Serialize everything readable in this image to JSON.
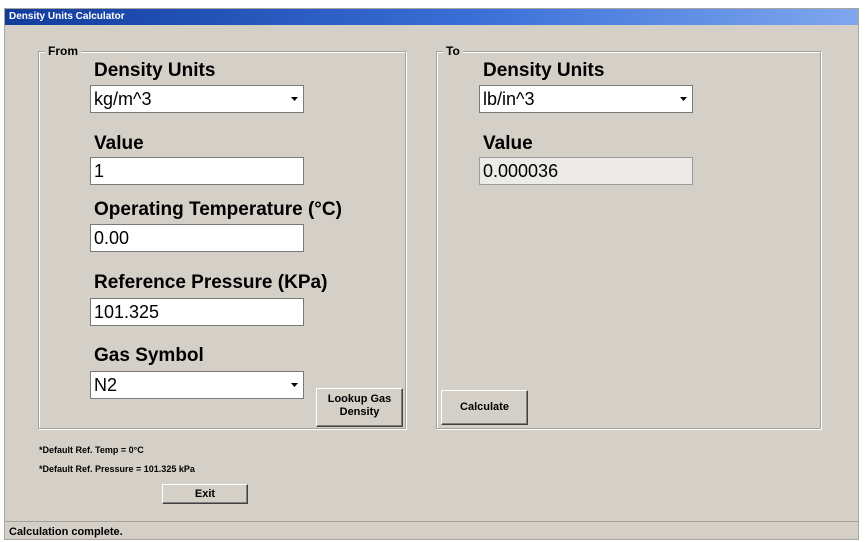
{
  "window": {
    "title": "Density Units Calculator"
  },
  "from": {
    "group_label": "From",
    "density_units_label": "Density Units",
    "density_units_value": "kg/m^3",
    "value_label": "Value",
    "value": "1",
    "temp_label": "Operating Temperature (°C)",
    "temp_value": "0.00",
    "pressure_label": "Reference Pressure (KPa)",
    "pressure_value": "101.325",
    "gas_label": "Gas Symbol",
    "gas_value": "N2",
    "lookup_button_line1": "Lookup Gas",
    "lookup_button_line2": "Density"
  },
  "to": {
    "group_label": "To",
    "density_units_label": "Density Units",
    "density_units_value": "lb/in^3",
    "value_label": "Value",
    "value": "0.000036",
    "calculate_label": "Calculate"
  },
  "notes": {
    "default_temp": "*Default Ref. Temp = 0°C",
    "default_pressure": "*Default Ref. Pressure = 101.325 kPa"
  },
  "exit_label": "Exit",
  "status": "Calculation complete."
}
